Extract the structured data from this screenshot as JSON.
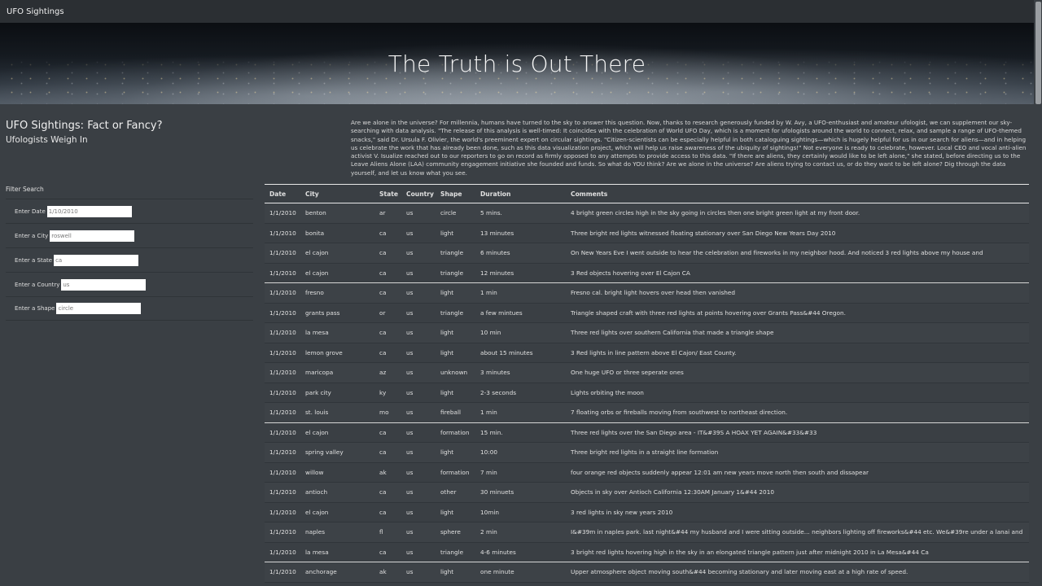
{
  "navbar": {
    "brand": "UFO Sightings"
  },
  "hero": {
    "title": "The Truth is Out There"
  },
  "intro": {
    "title": "UFO Sightings: Fact or Fancy?",
    "subtitle": "Ufologists Weigh In"
  },
  "article": "Are we alone in the universe? For millennia, humans have turned to the sky to answer this question. Now, thanks to research generously funded by W. Avy, a UFO-enthusiast and amateur ufologist, we can supplement our sky-searching with data analysis. \"The release of this analysis is well-timed: It coincides with the celebration of World UFO Day, which is a moment for ufologists around the world to connect, relax, and sample a range of UFO-themed snacks,\" said Dr. Ursula F. Olivier, the world's preeminent expert on circular sightings. \"Citizen-scientists can be especially helpful in both cataloguing sightings—which is hugely helpful for us in our search for aliens—and in helping us celebrate the work that has already been done, such as this data visualization project, which will help us raise awareness of the ubiquity of sightings!\" Not everyone is ready to celebrate, however. Local CEO and vocal anti-alien activist V. Isualize reached out to our reporters to go on record as firmly opposed to any attempts to provide access to this data. \"If there are aliens, they certainly would like to be left alone,\" she stated, before directing us to the Leave Aliens Alone (LAA) community engagement initiative she founded and funds. So what do YOU think? Are we alone in the universe? Are aliens trying to contact us, or do they want to be left alone? Dig through the data yourself, and let us know what you see.",
  "filters": {
    "heading": "Filter Search",
    "items": [
      {
        "label": "Enter Date",
        "value": "1/10/2010",
        "name": "date"
      },
      {
        "label": "Enter a City",
        "value": "roswell",
        "name": "city"
      },
      {
        "label": "Enter a State",
        "value": "ca",
        "name": "state"
      },
      {
        "label": "Enter a Country",
        "value": "us",
        "name": "country"
      },
      {
        "label": "Enter a Shape",
        "value": "circle",
        "name": "shape"
      }
    ]
  },
  "table": {
    "headers": [
      "Date",
      "City",
      "State",
      "Country",
      "Shape",
      "Duration",
      "Comments"
    ],
    "rows": [
      [
        "1/1/2010",
        "benton",
        "ar",
        "us",
        "circle",
        "5 mins.",
        "4 bright green circles high in the sky going in circles then one bright green light at my front door."
      ],
      [
        "1/1/2010",
        "bonita",
        "ca",
        "us",
        "light",
        "13 minutes",
        "Three bright red lights witnessed floating stationary over San Diego New Years Day 2010"
      ],
      [
        "1/1/2010",
        "el cajon",
        "ca",
        "us",
        "triangle",
        "6 minutes",
        "On New Years Eve I went outside to hear the celebration and fireworks in my neighbor hood. And noticed 3 red lights above my house and"
      ],
      [
        "1/1/2010",
        "el cajon",
        "ca",
        "us",
        "triangle",
        "12 minutes",
        "3 Red objects hovering over El Cajon CA"
      ],
      [
        "1/1/2010",
        "fresno",
        "ca",
        "us",
        "light",
        "1 min",
        "Fresno cal. bright light hovers over head then vanished"
      ],
      [
        "1/1/2010",
        "grants pass",
        "or",
        "us",
        "triangle",
        "a few mintues",
        "Triangle shaped craft with three red lights at points hovering over Grants Pass&#44 Oregon."
      ],
      [
        "1/1/2010",
        "la mesa",
        "ca",
        "us",
        "light",
        "10 min",
        "Three red lights over southern California that made a triangle shape"
      ],
      [
        "1/1/2010",
        "lemon grove",
        "ca",
        "us",
        "light",
        "about 15 minutes",
        "3 Red lights in line pattern above El Cajon/ East County."
      ],
      [
        "1/1/2010",
        "maricopa",
        "az",
        "us",
        "unknown",
        "3 minutes",
        "One huge UFO or three seperate ones"
      ],
      [
        "1/1/2010",
        "park city",
        "ky",
        "us",
        "light",
        "2-3 seconds",
        "Lights orbiting the moon"
      ],
      [
        "1/1/2010",
        "st. louis",
        "mo",
        "us",
        "fireball",
        "1 min",
        "7 floating orbs or fireballs moving from southwest to northeast direction."
      ],
      [
        "1/1/2010",
        "el cajon",
        "ca",
        "us",
        "formation",
        "15 min.",
        "Three red lights over the San Diego area - IT&#39S A HOAX YET AGAIN&#33&#33"
      ],
      [
        "1/1/2010",
        "spring valley",
        "ca",
        "us",
        "light",
        "10:00",
        "Three bright red lights in a straight line formation"
      ],
      [
        "1/1/2010",
        "willow",
        "ak",
        "us",
        "formation",
        "7 min",
        "four orange red objects suddenly appear 12:01 am new years move north then south and dissapear"
      ],
      [
        "1/1/2010",
        "antioch",
        "ca",
        "us",
        "other",
        "30 minuets",
        "Objects in sky over Antioch California 12:30AM January 1&#44 2010"
      ],
      [
        "1/1/2010",
        "el cajon",
        "ca",
        "us",
        "light",
        "10min",
        "3 red lights in sky new years 2010"
      ],
      [
        "1/1/2010",
        "naples",
        "fl",
        "us",
        "sphere",
        "2 min",
        "I&#39m in naples park. last night&#44 my husband and I were sitting outside... neighbors lighting off fireworks&#44 etc. We&#39re under a lanai and"
      ],
      [
        "1/1/2010",
        "la mesa",
        "ca",
        "us",
        "triangle",
        "4-6 minutes",
        "3 bright red lights hovering high in the sky in an elongated triangle pattern just after midnight 2010 in La Mesa&#44 Ca"
      ],
      [
        "1/1/2010",
        "anchorage",
        "ak",
        "us",
        "light",
        "one minute",
        "Upper atmosphere object moving south&#44 becoming stationary and later moving east at a high rate of speed."
      ]
    ]
  }
}
